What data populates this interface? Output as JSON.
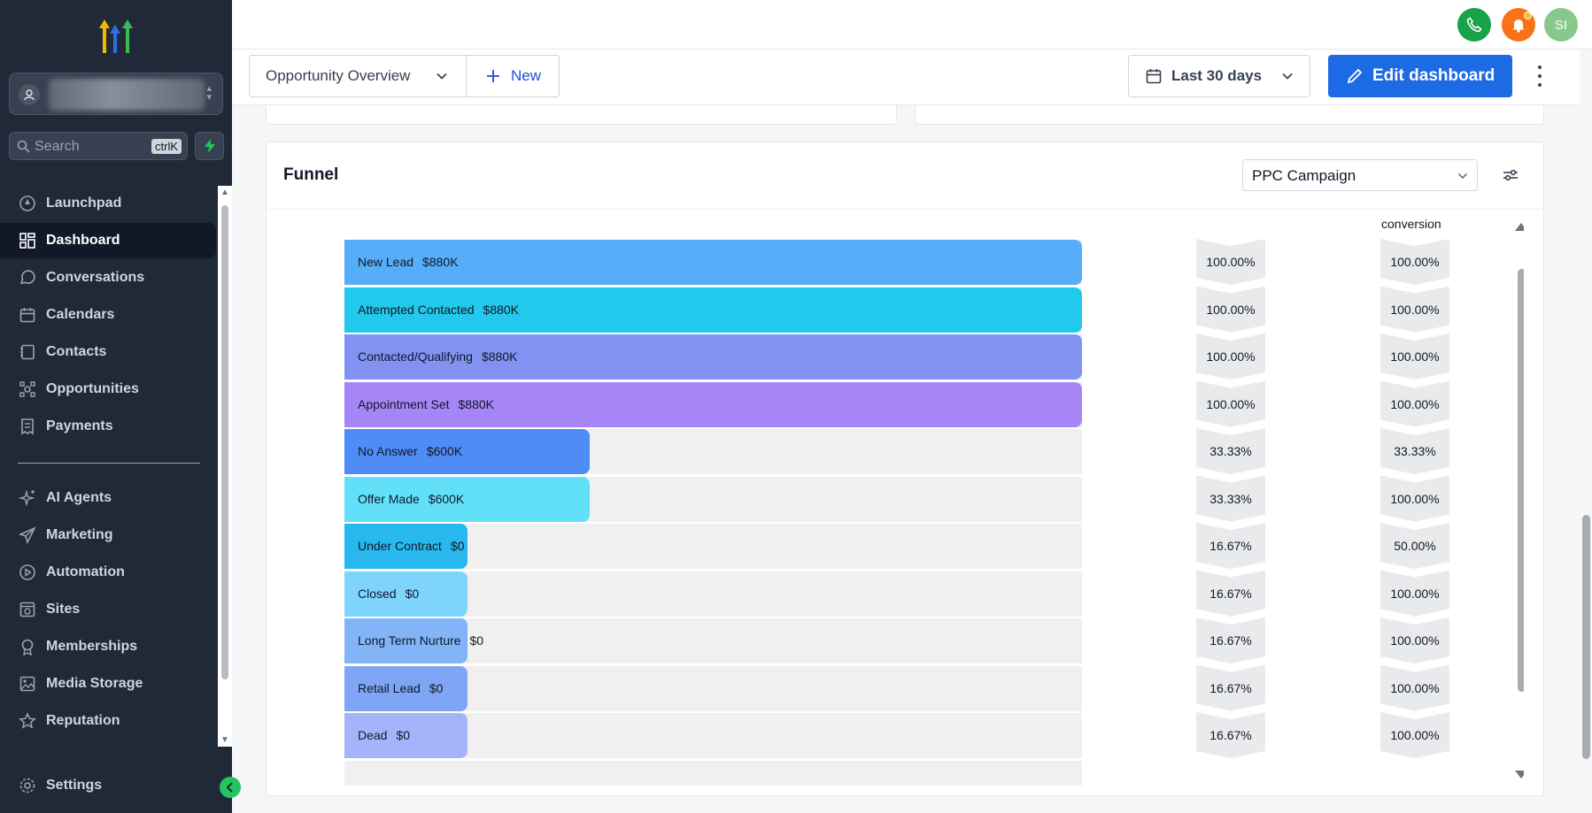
{
  "sidebar": {
    "search_placeholder": "Search",
    "search_shortcut": "ctrlK",
    "items": [
      {
        "label": "Launchpad",
        "icon": "rocket-icon"
      },
      {
        "label": "Dashboard",
        "icon": "grid-icon",
        "active": true
      },
      {
        "label": "Conversations",
        "icon": "chat-icon"
      },
      {
        "label": "Calendars",
        "icon": "calendar-icon"
      },
      {
        "label": "Contacts",
        "icon": "contacts-icon"
      },
      {
        "label": "Opportunities",
        "icon": "opportunities-icon"
      },
      {
        "label": "Payments",
        "icon": "receipt-icon"
      },
      {
        "label": "AI Agents",
        "icon": "sparkle-icon"
      },
      {
        "label": "Marketing",
        "icon": "send-icon"
      },
      {
        "label": "Automation",
        "icon": "automation-icon"
      },
      {
        "label": "Sites",
        "icon": "sites-icon"
      },
      {
        "label": "Memberships",
        "icon": "badge-icon"
      },
      {
        "label": "Media Storage",
        "icon": "image-icon"
      },
      {
        "label": "Reputation",
        "icon": "star-icon"
      }
    ],
    "settings_label": "Settings"
  },
  "topbar": {
    "avatar_initials": "SI"
  },
  "toolbar": {
    "dashboard_name": "Opportunity Overview",
    "new_label": "New",
    "date_range": "Last 30 days",
    "edit_label": "Edit dashboard"
  },
  "funnel": {
    "title": "Funnel",
    "pipeline": "PPC Campaign",
    "conversion_header": "conversion"
  },
  "colors": {
    "sidebar_bg": "#1f2937",
    "accent": "#1d6ae5"
  },
  "chart_data": {
    "type": "bar",
    "orientation": "horizontal",
    "categories": [
      "New Lead",
      "Attempted Contacted",
      "Contacted/Qualifying",
      "Appointment Set",
      "No Answer",
      "Offer Made",
      "Under Contract",
      "Closed",
      "Long Term Nurture",
      "Retail Lead",
      "Dead"
    ],
    "amounts": [
      "$880K",
      "$880K",
      "$880K",
      "$880K",
      "$600K",
      "$600K",
      "$0",
      "$0",
      "$0",
      "$0",
      "$0"
    ],
    "bar_fill_fraction": [
      1,
      1,
      1,
      1,
      0.333,
      0.333,
      0.167,
      0.167,
      0.167,
      0.167,
      0.167
    ],
    "bar_colors": [
      "#55aef7",
      "#22c9ec",
      "#8192f2",
      "#a686f7",
      "#4f8cf5",
      "#62e0f8",
      "#29b8ee",
      "#7fd4fb",
      "#82b5f8",
      "#7fa6f6",
      "#a4b4fa"
    ],
    "cumulative_pct": [
      "100.00%",
      "100.00%",
      "100.00%",
      "100.00%",
      "33.33%",
      "33.33%",
      "16.67%",
      "16.67%",
      "16.67%",
      "16.67%",
      "16.67%"
    ],
    "conversion_pct": [
      "100.00%",
      "100.00%",
      "100.00%",
      "100.00%",
      "33.33%",
      "100.00%",
      "50.00%",
      "100.00%",
      "100.00%",
      "100.00%",
      "100.00%"
    ]
  }
}
